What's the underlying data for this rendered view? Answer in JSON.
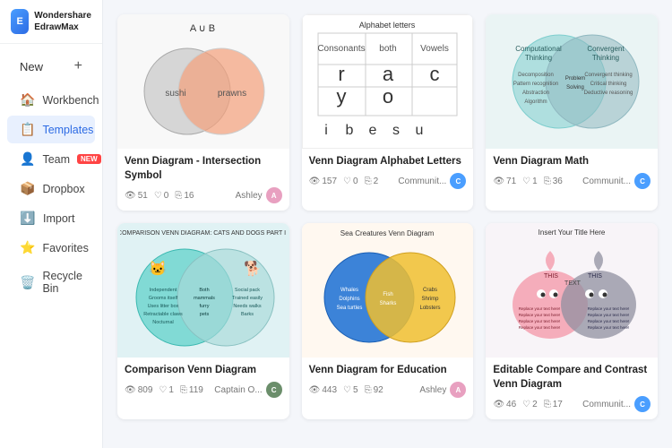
{
  "app": {
    "logo_line1": "Wondershare",
    "logo_line2": "EdrawMax"
  },
  "sidebar": {
    "new_label": "New",
    "items": [
      {
        "id": "workbench",
        "label": "Workbench",
        "icon": "🏠",
        "active": false
      },
      {
        "id": "templates",
        "label": "Templates",
        "icon": "📋",
        "active": true
      },
      {
        "id": "team",
        "label": "Team",
        "icon": "👤",
        "active": false,
        "badge": "NEW"
      },
      {
        "id": "dropbox",
        "label": "Dropbox",
        "icon": "📦",
        "active": false
      },
      {
        "id": "import",
        "label": "Import",
        "icon": "⬇️",
        "active": false
      },
      {
        "id": "favorites",
        "label": "Favorites",
        "icon": "⭐",
        "active": false
      },
      {
        "id": "recycle",
        "label": "Recycle Bin",
        "icon": "🗑️",
        "active": false
      }
    ]
  },
  "cards": [
    {
      "id": "card1",
      "title": "Venn Diagram - Intersection Symbol",
      "views": "51",
      "likes": "0",
      "copies": "16",
      "author": "Ashley",
      "author_color": "#e8a0c0",
      "author_initial": "A"
    },
    {
      "id": "card2",
      "title": "Venn Diagram Alphabet Letters",
      "views": "157",
      "likes": "0",
      "copies": "2",
      "author": "Communit...",
      "author_color": "#4a9eff",
      "author_initial": "C"
    },
    {
      "id": "card3",
      "title": "Venn Diagram Math",
      "views": "71",
      "likes": "1",
      "copies": "36",
      "author": "Communit...",
      "author_color": "#4a9eff",
      "author_initial": "C"
    },
    {
      "id": "card4",
      "title": "Comparison Venn Diagram",
      "views": "809",
      "likes": "1",
      "copies": "119",
      "author": "Captain O...",
      "author_color": "#6b8e6b",
      "author_initial": "C"
    },
    {
      "id": "card5",
      "title": "Venn Diagram for Education",
      "views": "443",
      "likes": "5",
      "copies": "92",
      "author": "Ashley",
      "author_color": "#e8a0c0",
      "author_initial": "A"
    },
    {
      "id": "card6",
      "title": "Editable Compare and Contrast Venn Diagram",
      "views": "46",
      "likes": "2",
      "copies": "17",
      "author": "Communit...",
      "author_color": "#4a9eff",
      "author_initial": "C"
    }
  ]
}
